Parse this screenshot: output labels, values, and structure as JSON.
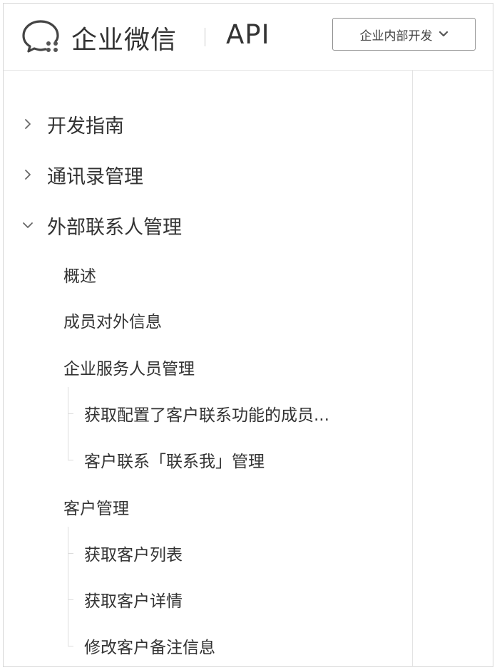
{
  "header": {
    "brand": "企业微信",
    "product": "API",
    "dev_type_select": "企业内部开发"
  },
  "sidebar": {
    "sections": [
      {
        "label": "开发指南",
        "expanded": false
      },
      {
        "label": "通讯录管理",
        "expanded": false
      },
      {
        "label": "外部联系人管理",
        "expanded": true
      }
    ],
    "external_contacts": {
      "overview": "概述",
      "member_external_info": "成员对外信息",
      "service_staff": {
        "label": "企业服务人员管理",
        "children": [
          "获取配置了客户联系功能的成员...",
          "客户联系「联系我」管理"
        ]
      },
      "customer_management": {
        "label": "客户管理",
        "children": [
          "获取客户列表",
          "获取客户详情",
          "修改客户备注信息"
        ]
      }
    }
  },
  "colors": {
    "text": "#333333",
    "border": "#e3e3e3",
    "tree_line": "#dcdcdc"
  }
}
